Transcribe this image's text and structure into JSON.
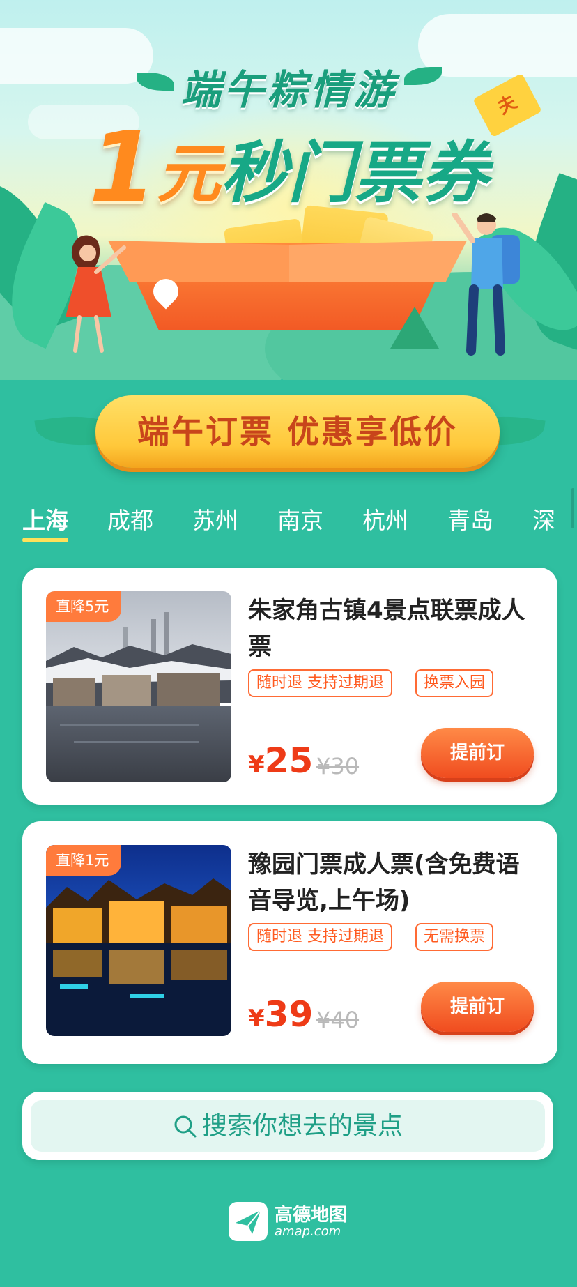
{
  "hero": {
    "title_line1": "端午粽情游",
    "title_big_number": "1",
    "title_yuan": "元",
    "title_rest": "秒门票券",
    "coupon_char": "夫"
  },
  "slogan": "端午订票  优惠享低价",
  "tabs": [
    "上海",
    "成都",
    "苏州",
    "南京",
    "杭州",
    "青岛",
    "深"
  ],
  "active_tab": "上海",
  "cards": [
    {
      "badge": "直降5元",
      "title": "朱家角古镇4景点联票成人票",
      "tags": [
        "随时退 支持过期退",
        "换票入园"
      ],
      "currency": "¥",
      "price": "25",
      "original_price": "¥30",
      "button": "提前订"
    },
    {
      "badge": "直降1元",
      "title": "豫园门票成人票(含免费语音导览,上午场)",
      "tags": [
        "随时退 支持过期退",
        "无需换票"
      ],
      "currency": "¥",
      "price": "39",
      "original_price": "¥40",
      "button": "提前订"
    }
  ],
  "search": {
    "placeholder": "搜索你想去的景点"
  },
  "footer": {
    "brand_cn": "高德地图",
    "brand_en": "amap.com"
  },
  "colors": {
    "background": "#2fbfa0",
    "accent_orange": "#ff7b3c",
    "price_red": "#ee3b17",
    "slogan_yellow": "#ffc83a"
  }
}
